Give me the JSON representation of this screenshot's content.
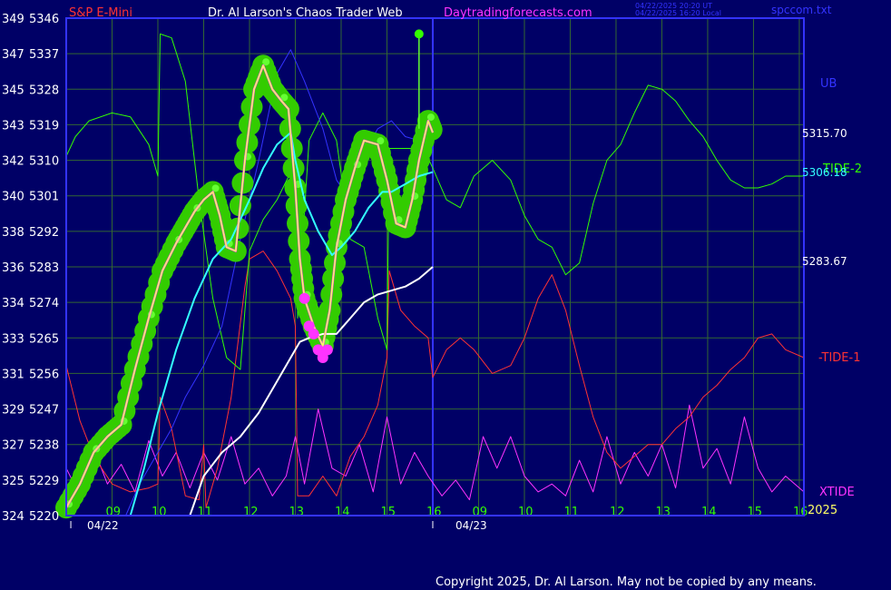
{
  "header": {
    "symbol": "S&P E-Mini",
    "site": "Dr. Al Larson's Chaos Trader Web",
    "url": "Daytradingforecasts.com",
    "time_utc": "04/22/2025 20:20 UT",
    "time_local": "04/22/2025 16:20 Local",
    "file": "spccom.txt"
  },
  "footer": {
    "copyright": "Copyright 2025, Dr. Al Larson. May not be copied by any means.",
    "year": "2025"
  },
  "colors": {
    "background": "#000066",
    "grid": "#336633",
    "frame": "#3333ff",
    "price": "#ffff66",
    "price_overlay": "#ff33ff",
    "bubbles": "#33cc00",
    "tide1": "#ff3333",
    "tide2": "#33ff00",
    "xtide": "#ff33ff",
    "ub": "#3333ff",
    "cyan_ma": "#33ffff",
    "white_ma": "#ffffff",
    "labels_left": "#ffffff",
    "labels_hours": "#33ff00",
    "symbol": "#ff3333",
    "url": "#ff33ff"
  },
  "chart_data": {
    "type": "line",
    "y_left_ticks": [
      "349",
      "347",
      "345",
      "343",
      "342",
      "340",
      "338",
      "336",
      "334",
      "333",
      "331",
      "329",
      "327",
      "325",
      "324"
    ],
    "y_right_ticks": [
      "5346",
      "5337",
      "5328",
      "5319",
      "5310",
      "5301",
      "5292",
      "5283",
      "5274",
      "5265",
      "5256",
      "5247",
      "5238",
      "5229",
      "5220"
    ],
    "y_tick_values": [
      5346,
      5337,
      5328,
      5319,
      5310,
      5301,
      5292,
      5283,
      5274,
      5265,
      5256,
      5247,
      5238,
      5229,
      5220
    ],
    "ylim": [
      5220,
      5346
    ],
    "x_hour_labels": [
      "09",
      "10",
      "11",
      "12",
      "13",
      "14",
      "15",
      "16",
      "09",
      "10",
      "11",
      "12",
      "13",
      "14",
      "15",
      "16"
    ],
    "x_date_labels": [
      "04/22",
      "04/23"
    ],
    "xlim": [
      8.0,
      24.1
    ],
    "right_labels": {
      "ub": "UB",
      "tide2": "TIDE-2",
      "tide1": "-TIDE-1",
      "xtide": "XTIDE",
      "value1": "5315.70",
      "value2": "5306.18",
      "value3": "5283.67"
    },
    "right_label_values": {
      "value1": 5315.7,
      "value2": 5306.18,
      "value3": 5283.67
    },
    "series": [
      {
        "key": "price",
        "x": [
          8.0,
          8.3,
          8.6,
          8.9,
          9.2,
          9.5,
          9.8,
          10.1,
          10.4,
          10.6,
          10.8,
          11.0,
          11.2,
          11.35,
          11.5,
          11.7,
          11.9,
          12.1,
          12.3,
          12.5,
          12.7,
          12.85,
          13.0,
          13.1,
          13.2,
          13.4,
          13.6,
          13.75,
          13.9,
          14.1,
          14.3,
          14.5,
          14.8,
          15.0,
          15.2,
          15.4,
          15.55,
          15.7,
          15.9,
          16.0
        ],
        "values": [
          5222,
          5228,
          5236,
          5240,
          5243,
          5257,
          5270,
          5282,
          5289,
          5293,
          5297,
          5300,
          5302,
          5296,
          5288,
          5287,
          5310,
          5328,
          5334,
          5328,
          5325,
          5323,
          5303,
          5285,
          5275,
          5268,
          5263,
          5272,
          5288,
          5300,
          5308,
          5315,
          5314,
          5305,
          5294,
          5293,
          5300,
          5310,
          5320,
          5317
        ]
      },
      {
        "key": "tide2",
        "x": [
          8.0,
          8.2,
          8.5,
          9.0,
          9.4,
          9.8,
          10.0,
          10.05,
          10.3,
          10.6,
          10.9,
          11.2,
          11.5,
          11.8,
          12.0,
          12.3,
          12.6,
          12.9,
          13.0,
          13.05,
          13.3,
          13.6,
          13.9,
          14.2,
          14.5,
          14.8,
          15.0,
          15.05,
          15.4,
          15.8,
          16.0,
          16.3,
          16.6,
          16.9,
          17.3,
          17.7,
          18.0,
          18.3,
          18.6,
          18.9,
          19.2,
          19.5,
          19.8,
          20.1,
          20.4,
          20.7,
          21.0,
          21.3,
          21.6,
          21.9,
          22.2,
          22.5,
          22.8,
          23.1,
          23.4,
          23.7,
          24.1
        ],
        "values": [
          5311,
          5316,
          5320,
          5322,
          5321,
          5314,
          5306,
          5342,
          5341,
          5330,
          5300,
          5275,
          5260,
          5257,
          5287,
          5295,
          5300,
          5307,
          5325,
          5270,
          5315,
          5322,
          5315,
          5290,
          5288,
          5270,
          5262,
          5313,
          5313,
          5313,
          5308,
          5300,
          5298,
          5306,
          5310,
          5305,
          5296,
          5290,
          5288,
          5281,
          5284,
          5299,
          5310,
          5314,
          5322,
          5329,
          5328,
          5325,
          5320,
          5316,
          5310,
          5305,
          5303,
          5303,
          5304,
          5306,
          5306
        ]
      },
      {
        "key": "tide1",
        "x": [
          8.0,
          8.3,
          8.6,
          9.0,
          9.4,
          9.8,
          10.0,
          10.05,
          10.3,
          10.6,
          10.9,
          11.0,
          11.05,
          11.3,
          11.6,
          11.9,
          12.0,
          12.3,
          12.6,
          12.9,
          13.0,
          13.05,
          13.3,
          13.6,
          13.9,
          14.2,
          14.5,
          14.8,
          15.0,
          15.05,
          15.3,
          15.6,
          15.9,
          16.0,
          16.3,
          16.6,
          16.9,
          17.3,
          17.7,
          18.0,
          18.3,
          18.6,
          18.9,
          19.2,
          19.5,
          19.8,
          20.1,
          20.4,
          20.7,
          21.0,
          21.3,
          21.6,
          21.9,
          22.2,
          22.5,
          22.8,
          23.1,
          23.4,
          23.7,
          24.1
        ],
        "values": [
          5258,
          5244,
          5235,
          5228,
          5226,
          5227,
          5228,
          5250,
          5242,
          5225,
          5224,
          5238,
          5222,
          5232,
          5250,
          5278,
          5285,
          5287,
          5282,
          5275,
          5268,
          5225,
          5225,
          5230,
          5225,
          5235,
          5240,
          5248,
          5260,
          5282,
          5272,
          5268,
          5265,
          5255,
          5262,
          5265,
          5262,
          5256,
          5258,
          5265,
          5275,
          5281,
          5272,
          5258,
          5245,
          5236,
          5232,
          5235,
          5238,
          5238,
          5242,
          5245,
          5250,
          5253,
          5257,
          5260,
          5265,
          5266,
          5262,
          5260
        ]
      },
      {
        "key": "xtide",
        "x": [
          8.0,
          8.3,
          8.6,
          8.9,
          9.2,
          9.5,
          9.8,
          10.1,
          10.4,
          10.7,
          11.0,
          11.3,
          11.6,
          11.9,
          12.2,
          12.5,
          12.8,
          13.0,
          13.2,
          13.5,
          13.8,
          14.1,
          14.4,
          14.7,
          15.0,
          15.3,
          15.6,
          15.9,
          16.2,
          16.5,
          16.8,
          17.1,
          17.4,
          17.7,
          18.0,
          18.3,
          18.6,
          18.9,
          19.2,
          19.5,
          19.8,
          20.1,
          20.4,
          20.7,
          21.0,
          21.3,
          21.6,
          21.9,
          22.2,
          22.5,
          22.8,
          23.1,
          23.4,
          23.7,
          24.1
        ],
        "values": [
          5232,
          5225,
          5237,
          5228,
          5233,
          5226,
          5239,
          5230,
          5236,
          5227,
          5236,
          5229,
          5240,
          5228,
          5232,
          5225,
          5230,
          5240,
          5228,
          5247,
          5232,
          5230,
          5238,
          5226,
          5245,
          5228,
          5236,
          5230,
          5225,
          5229,
          5224,
          5240,
          5232,
          5240,
          5230,
          5226,
          5228,
          5225,
          5234,
          5226,
          5240,
          5228,
          5236,
          5230,
          5238,
          5227,
          5248,
          5232,
          5237,
          5228,
          5245,
          5232,
          5226,
          5230,
          5226
        ]
      },
      {
        "key": "ub",
        "x": [
          9.3,
          9.6,
          10.0,
          10.3,
          10.6,
          11.0,
          11.4,
          11.8,
          12.2,
          12.6,
          12.9,
          13.2,
          13.6,
          13.9,
          14.2,
          14.5,
          14.8,
          15.1,
          15.4,
          15.7,
          16.0
        ],
        "values": [
          5220,
          5228,
          5236,
          5242,
          5250,
          5258,
          5268,
          5290,
          5310,
          5332,
          5338,
          5330,
          5318,
          5305,
          5300,
          5312,
          5318,
          5320,
          5316,
          5315,
          5315
        ]
      },
      {
        "key": "cyan_ma",
        "x": [
          9.4,
          9.7,
          10.0,
          10.4,
          10.8,
          11.2,
          11.6,
          12.0,
          12.3,
          12.6,
          12.9,
          13.0,
          13.2,
          13.5,
          13.8,
          14.0,
          14.3,
          14.6,
          14.9,
          15.1,
          15.4,
          15.7,
          16.0
        ],
        "values": [
          5220,
          5232,
          5246,
          5262,
          5275,
          5285,
          5290,
          5300,
          5308,
          5314,
          5317,
          5310,
          5300,
          5292,
          5286,
          5288,
          5292,
          5298,
          5302,
          5302,
          5304,
          5306,
          5307
        ]
      },
      {
        "key": "white_ma",
        "x": [
          10.7,
          11.0,
          11.4,
          11.8,
          12.2,
          12.6,
          12.9,
          13.1,
          13.3,
          13.6,
          13.9,
          14.2,
          14.5,
          14.8,
          15.1,
          15.4,
          15.7,
          16.0
        ],
        "values": [
          5220,
          5230,
          5236,
          5240,
          5246,
          5254,
          5260,
          5264,
          5265,
          5266,
          5266,
          5270,
          5274,
          5276,
          5277,
          5278,
          5280,
          5283
        ]
      }
    ],
    "upper_spike": {
      "x": 15.7,
      "value": 5342
    },
    "magenta_dots": {
      "x": [
        13.2,
        13.3,
        13.4,
        13.5,
        13.6,
        13.7
      ],
      "values": [
        5275,
        5268,
        5266,
        5262,
        5260,
        5262
      ]
    },
    "grid": true
  }
}
